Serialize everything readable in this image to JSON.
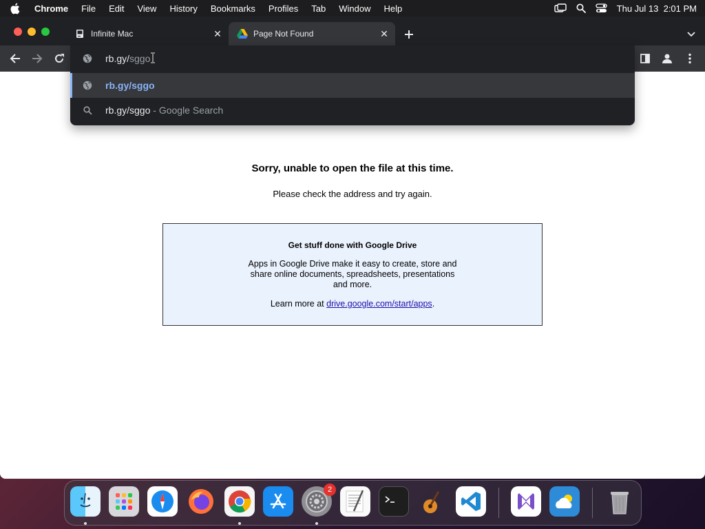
{
  "menubar": {
    "app_name": "Chrome",
    "items": [
      "File",
      "Edit",
      "View",
      "History",
      "Bookmarks",
      "Profiles",
      "Tab",
      "Window",
      "Help"
    ],
    "datetime": "Thu Jul 13  2:01 PM"
  },
  "tabs": [
    {
      "title": "Infinite Mac",
      "favicon": "mac-icon",
      "active": false
    },
    {
      "title": "Page Not Found",
      "favicon": "google-drive-icon",
      "active": true
    }
  ],
  "omnibox": {
    "typed": "rb.gy/",
    "autocomplete": "sggo",
    "suggestions": [
      {
        "text": "rb.gy/sggo",
        "icon": "globe-icon",
        "selected": true
      },
      {
        "text": "rb.gy/sggo",
        "suffix": "- Google Search",
        "icon": "search-icon",
        "selected": false
      }
    ]
  },
  "page": {
    "error_title": "Sorry, unable to open the file at this time.",
    "error_subtitle": "Please check the address and try again.",
    "promo": {
      "title": "Get stuff done with Google Drive",
      "body": "Apps in Google Drive make it easy to create, store and share online documents, spreadsheets, presentations and more.",
      "learn_prefix": "Learn more at ",
      "learn_link": "drive.google.com/start/apps",
      "learn_suffix": "."
    }
  },
  "dock": {
    "items": [
      "finder-icon",
      "launchpad-icon",
      "safari-icon",
      "firefox-icon",
      "chrome-icon",
      "app-store-icon",
      "system-settings-icon",
      "textedit-icon",
      "terminal-icon",
      "garageband-icon",
      "vscode-icon",
      "visual-studio-icon",
      "weather-icon",
      "trash-icon"
    ],
    "settings_badge": "2"
  },
  "colors": {
    "accent": "#8ab4f8",
    "tabstrip": "#202124",
    "toolbar": "#35363a",
    "promo_bg": "#eaf2fd"
  }
}
